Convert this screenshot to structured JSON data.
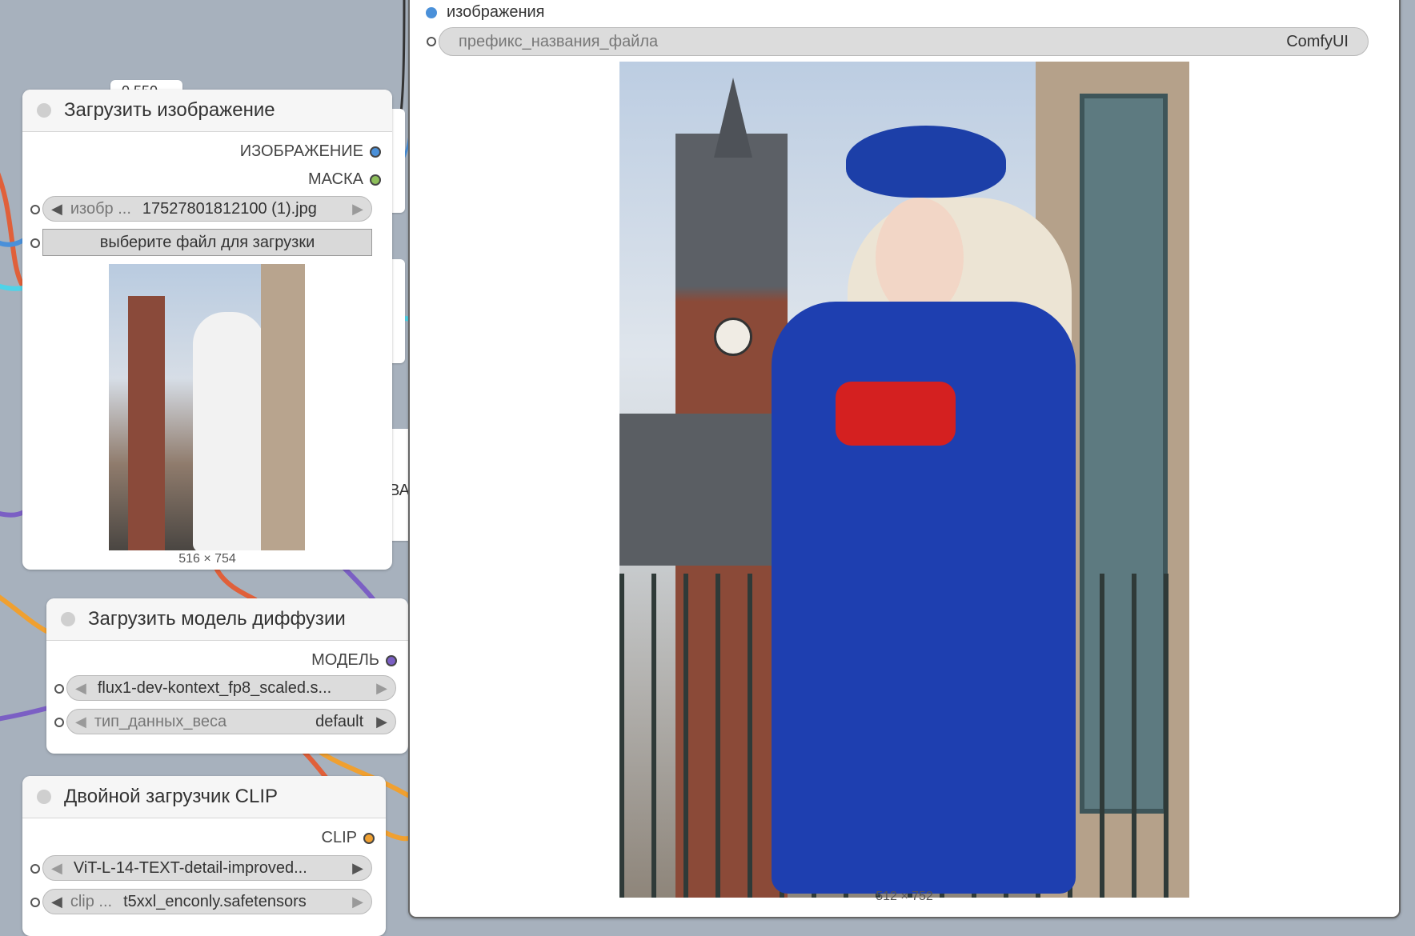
{
  "canvas": {
    "partial_label": "0.550",
    "partial_text": "ВАН"
  },
  "load_image": {
    "title": "Загрузить изображение",
    "out_image": "ИЗОБРАЖЕНИЕ",
    "out_mask": "МАСКА",
    "image_label": "изобр ...",
    "image_value": "17527801812100 (1).jpg",
    "upload_button": "выберите файл для загрузки",
    "preview_size": "516 × 754"
  },
  "diffusion": {
    "title": "Загрузить модель диффузии",
    "out_model": "МОДЕЛЬ",
    "model_value": "flux1-dev-kontext_fp8_scaled.s...",
    "dtype_label": "тип_данных_веса",
    "dtype_value": "default"
  },
  "clip": {
    "title": "Двойной загрузчик CLIP",
    "out_clip": "CLIP",
    "clip1_value": "ViT-L-14-TEXT-detail-improved...",
    "clip2_label": "clip ...",
    "clip2_value": "t5xxl_enconly.safetensors"
  },
  "save": {
    "input_label": "изображения",
    "prefix_label": "префикс_названия_файла",
    "prefix_value": "ComfyUI",
    "image_size": "512 × 752"
  },
  "colors": {
    "image_port": "#4a90d9",
    "mask_port": "#8dbf5a",
    "model_port": "#7b5fc4",
    "clip_port": "#f0a030"
  }
}
